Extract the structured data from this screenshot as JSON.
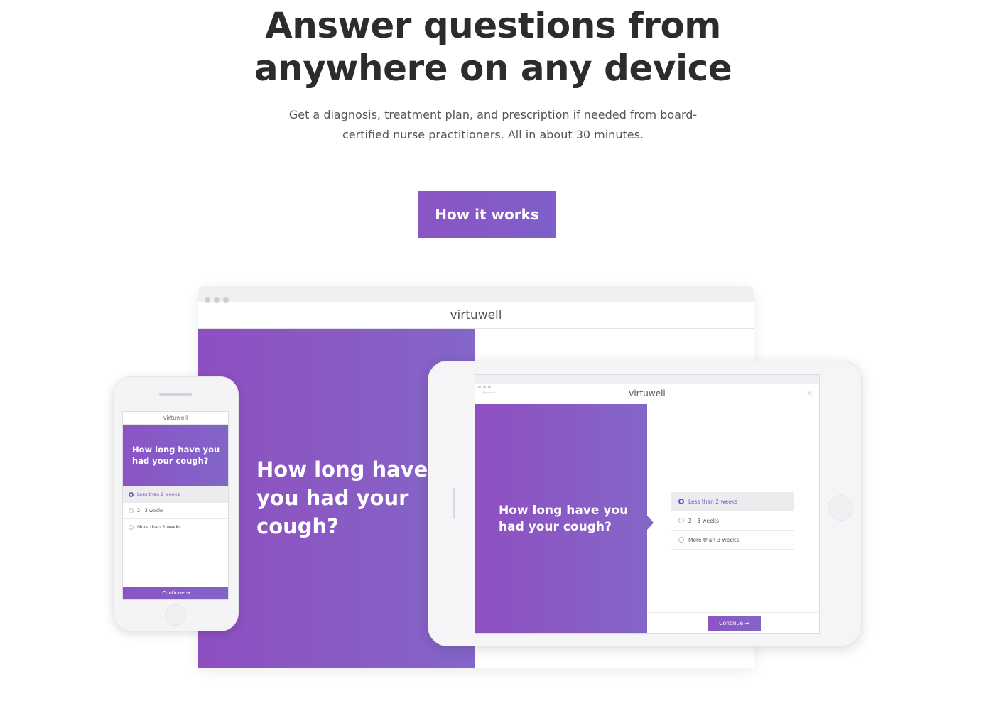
{
  "hero": {
    "title_line1": "Answer questions from",
    "title_line2": "anywhere on any device",
    "subtitle_line1": "Get a diagnosis, treatment plan, and prescription if needed from board-",
    "subtitle_line2": "certified nurse practitioners. All in about 30 minutes.",
    "cta_label": "How it works"
  },
  "brand": "virtuwell",
  "question": "How long have you had your cough?",
  "options": [
    "Less than 2 weeks",
    "2 - 3 weeks",
    "More than 3 weeks"
  ],
  "selected_option_index": 0,
  "continue_label": "Continue →",
  "colors": {
    "accent_start": "#8e4fc0",
    "accent_end": "#8466c8",
    "heading": "#2c2c2c",
    "body_text": "#555555"
  },
  "icons": {
    "back": "back-arrow-icon",
    "close": "close-icon",
    "radio_selected": "radio-selected-icon",
    "radio": "radio-icon"
  }
}
